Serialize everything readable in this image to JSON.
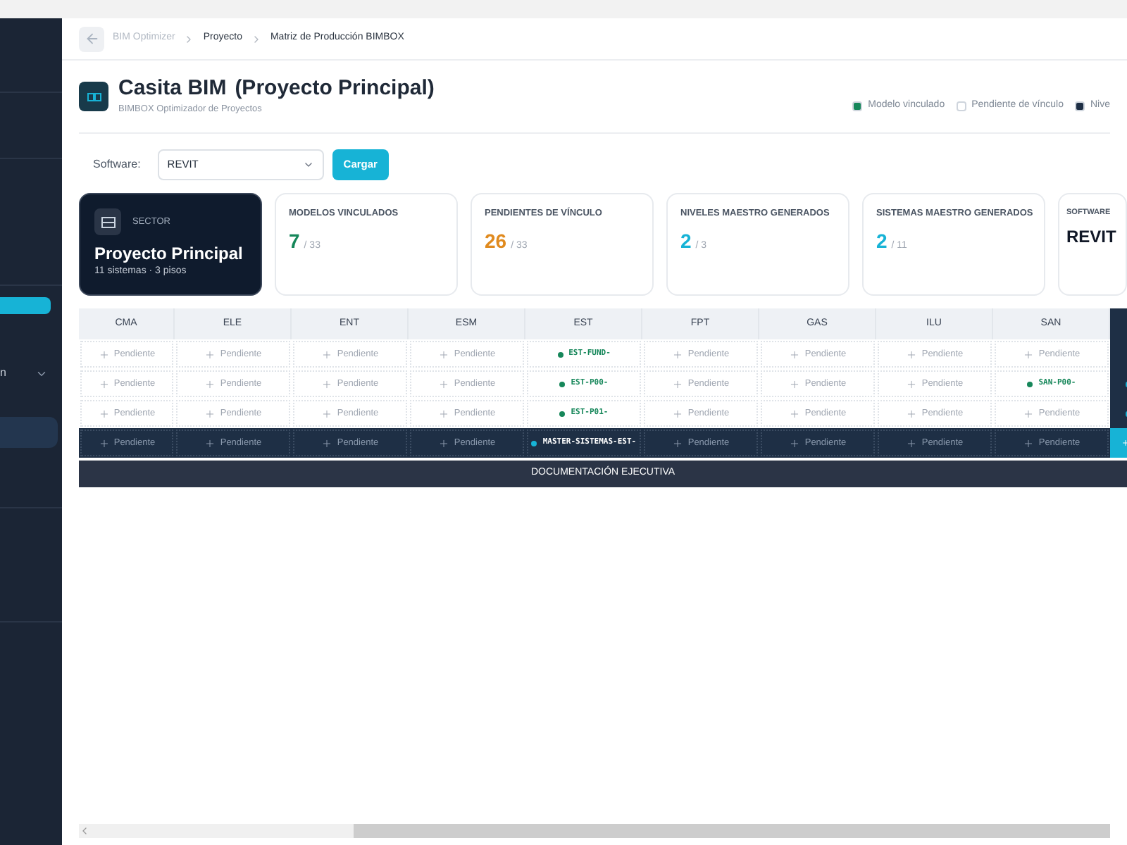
{
  "sidebar": {
    "cut_label": "n"
  },
  "breadcrumb": [
    "BIM Optimizer",
    "Proyecto",
    "Matriz de Producción BIMBOX"
  ],
  "header": {
    "title": "Casita BIM",
    "title_suffix": "(Proyecto Principal)",
    "subtitle": "BIMBOX Optimizador de Proyectos"
  },
  "legend": [
    {
      "label": "Modelo vinculado",
      "color": "#16875a"
    },
    {
      "label": "Pendiente de vínculo",
      "color": "#ffffff"
    },
    {
      "label": "Nive",
      "color": "#1e2f45"
    }
  ],
  "software": {
    "label": "Software:",
    "value": "REVIT",
    "button": "Cargar"
  },
  "sector_card": {
    "kicker": "SECTOR",
    "title": "Proyecto Principal",
    "subtitle": "11 sistemas · 3 pisos"
  },
  "stats": [
    {
      "label": "MODELOS VINCULADOS",
      "value": "7",
      "total": "/ 33",
      "color": "#16875a"
    },
    {
      "label": "PENDIENTES DE VÍNCULO",
      "value": "26",
      "total": "/ 33",
      "color": "#e08a1e"
    },
    {
      "label": "NIVELES MAESTRO GENERADOS",
      "value": "2",
      "total": "/ 3",
      "color": "#17b3d6"
    },
    {
      "label": "SISTEMAS MAESTRO GENERADOS",
      "value": "2",
      "total": "/ 11",
      "color": "#17b3d6"
    },
    {
      "label": "SOFTWARE",
      "value": "REVIT",
      "color": "#111827"
    }
  ],
  "matrix": {
    "columns": [
      "CMA",
      "ELE",
      "ENT",
      "ESM",
      "EST",
      "FPT",
      "GAS",
      "ILU",
      "SAN"
    ],
    "rows": [
      {
        "kind": "level",
        "cells": [
          {
            "kind": "pending",
            "text": "Pendiente"
          },
          {
            "kind": "pending",
            "text": "Pendiente"
          },
          {
            "kind": "pending",
            "text": "Pendiente"
          },
          {
            "kind": "pending",
            "text": "Pendiente"
          },
          {
            "kind": "linked",
            "text": "EST-FUND-"
          },
          {
            "kind": "pending",
            "text": "Pendiente"
          },
          {
            "kind": "pending",
            "text": "Pendiente"
          },
          {
            "kind": "pending",
            "text": "Pendiente"
          },
          {
            "kind": "pending",
            "text": "Pendiente"
          }
        ],
        "edge": {
          "kind": "none"
        }
      },
      {
        "kind": "level",
        "cells": [
          {
            "kind": "pending",
            "text": "Pendiente"
          },
          {
            "kind": "pending",
            "text": "Pendiente"
          },
          {
            "kind": "pending",
            "text": "Pendiente"
          },
          {
            "kind": "pending",
            "text": "Pendiente"
          },
          {
            "kind": "linked",
            "text": "EST-P00-"
          },
          {
            "kind": "pending",
            "text": "Pendiente"
          },
          {
            "kind": "pending",
            "text": "Pendiente"
          },
          {
            "kind": "pending",
            "text": "Pendiente"
          },
          {
            "kind": "linked",
            "text": "SAN-P00-"
          }
        ],
        "edge": {
          "kind": "dot"
        }
      },
      {
        "kind": "level",
        "cells": [
          {
            "kind": "pending",
            "text": "Pendiente"
          },
          {
            "kind": "pending",
            "text": "Pendiente"
          },
          {
            "kind": "pending",
            "text": "Pendiente"
          },
          {
            "kind": "pending",
            "text": "Pendiente"
          },
          {
            "kind": "linked",
            "text": "EST-P01-"
          },
          {
            "kind": "pending",
            "text": "Pendiente"
          },
          {
            "kind": "pending",
            "text": "Pendiente"
          },
          {
            "kind": "pending",
            "text": "Pendiente"
          },
          {
            "kind": "pending",
            "text": "Pendiente"
          }
        ],
        "edge": {
          "kind": "dot"
        }
      },
      {
        "kind": "master",
        "cells": [
          {
            "kind": "pending",
            "text": "Pendiente"
          },
          {
            "kind": "pending",
            "text": "Pendiente"
          },
          {
            "kind": "pending",
            "text": "Pendiente"
          },
          {
            "kind": "pending",
            "text": "Pendiente"
          },
          {
            "kind": "linked",
            "text": "MASTER-SISTEMAS-EST-"
          },
          {
            "kind": "pending",
            "text": "Pendiente"
          },
          {
            "kind": "pending",
            "text": "Pendiente"
          },
          {
            "kind": "pending",
            "text": "Pendiente"
          },
          {
            "kind": "pending",
            "text": "Pendiente"
          }
        ],
        "edge": {
          "kind": "plus"
        }
      }
    ],
    "footer": "DOCUMENTACIÓN EJECUTIVA"
  }
}
